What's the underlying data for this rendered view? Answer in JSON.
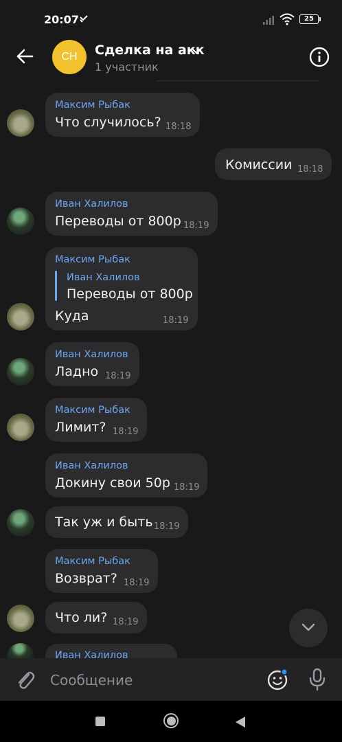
{
  "status": {
    "time": "20:07",
    "battery": "25"
  },
  "header": {
    "avatar_initials": "СН",
    "title": "Сделка на акк",
    "subtitle": "1 участник"
  },
  "messages": [
    {
      "author": "Максим Рыбак",
      "text": "Что случилось?",
      "time": "18:18"
    },
    {
      "author": "",
      "text": "Комиссии",
      "time": "18:18"
    },
    {
      "author": "Иван Халилов",
      "text": "Переводы от 800р",
      "time": "18:19"
    },
    {
      "author": "Максим Рыбак",
      "reply_author": "Иван Халилов",
      "reply_text": "Переводы от 800р",
      "text": "Куда",
      "time": "18:19"
    },
    {
      "author": "Иван Халилов",
      "text": "Ладно",
      "time": "18:19"
    },
    {
      "author": "Максим Рыбак",
      "text": "Лимит?",
      "time": "18:19"
    },
    {
      "author": "Иван Халилов",
      "text": "Докину свои 50р",
      "time": "18:19"
    },
    {
      "author": "",
      "text": "Так уж и быть",
      "time": "18:19"
    },
    {
      "author": "Максим Рыбак",
      "text": "Возврат?",
      "time": "18:19"
    },
    {
      "author": "",
      "text": "Что ли?",
      "time": "18:19"
    },
    {
      "author": "Иван Халилов",
      "text": "",
      "time": ""
    }
  ],
  "composer": {
    "placeholder": "Сообщение"
  },
  "icons": {
    "back": "arrow-left-icon",
    "info": "info-icon",
    "attach": "paperclip-icon",
    "emoji": "emoji-icon",
    "mic": "microphone-icon",
    "scroll": "chevron-down-icon"
  },
  "colors": {
    "accent": "#6ea6ef",
    "avatar": "#f2c12e",
    "bubble": "#2c2c2e",
    "background": "#19191a"
  }
}
